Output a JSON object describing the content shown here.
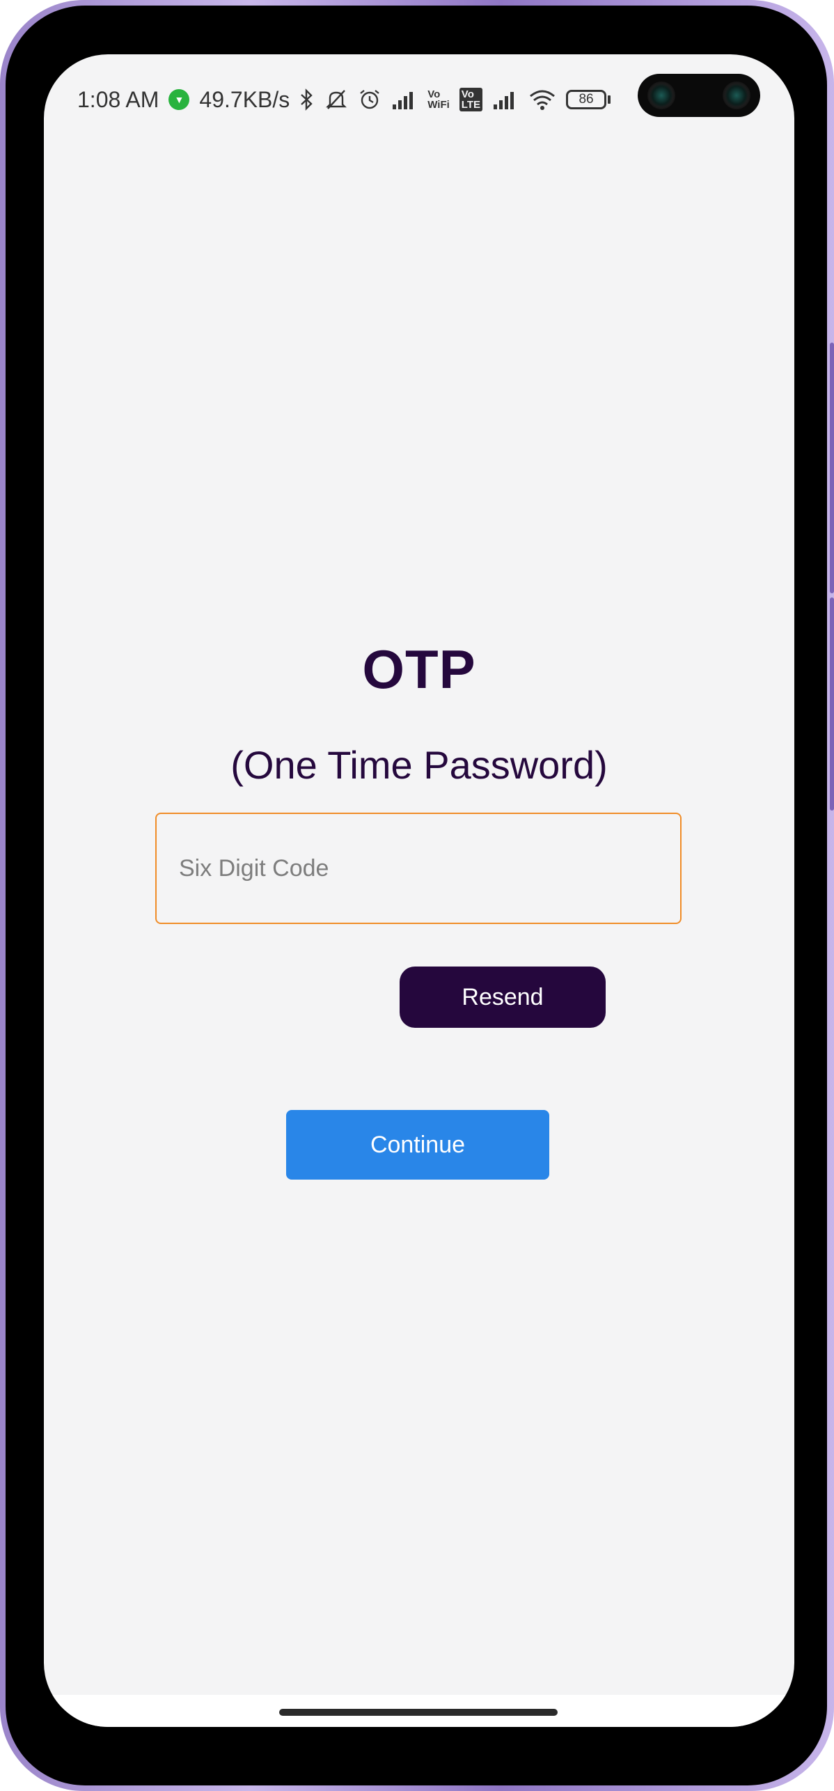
{
  "status_bar": {
    "time": "1:08 AM",
    "network_speed": "49.7KB/s",
    "volte_wifi_top": "Vo",
    "volte_wifi_bottom": "WiFi",
    "volte_lte_top": "Vo",
    "volte_lte_bottom": "LTE",
    "battery_level": "86",
    "icons": [
      "data-saver-icon",
      "bluetooth-icon",
      "mute-icon",
      "alarm-icon",
      "signal-icon",
      "wifi-icon",
      "battery-icon"
    ]
  },
  "screen": {
    "title": "OTP",
    "subtitle": "(One Time Password)",
    "code_input": {
      "placeholder": "Six Digit Code",
      "value": ""
    },
    "resend_label": "Resend",
    "continue_label": "Continue"
  },
  "colors": {
    "title_color": "#25083d",
    "input_border": "#f08c26",
    "resend_bg": "#25073d",
    "continue_bg": "#2986e8",
    "background": "#f4f4f5"
  }
}
